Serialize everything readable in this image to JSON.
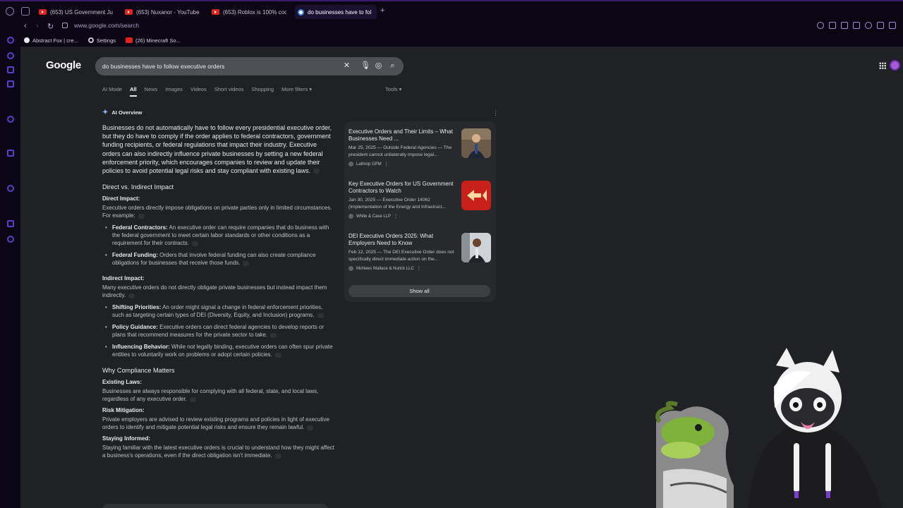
{
  "browser": {
    "tabs": [
      {
        "label": "(653) US Government Ju",
        "icon": "youtube-icon"
      },
      {
        "label": "(653) Nuxanor - YouTube",
        "icon": "youtube-icon"
      },
      {
        "label": "(653) Roblox is 100% coo",
        "icon": "youtube-icon"
      },
      {
        "label": "do businesses have to fol",
        "icon": "google-icon",
        "active": true
      }
    ],
    "new_tab": "+",
    "url": "www.google.com/search",
    "bookmarks": [
      {
        "label": "Abstract Fox | cre..."
      },
      {
        "label": "Settings"
      },
      {
        "label": "(26) Minecraft So..."
      }
    ]
  },
  "google": {
    "logo": "Google",
    "query": "do businesses have to follow executive orders",
    "tabs": [
      "AI Mode",
      "All",
      "News",
      "Images",
      "Videos",
      "Short videos",
      "Shopping",
      "More filters"
    ],
    "active_tab": "All",
    "tools": "Tools"
  },
  "ai_overview": {
    "heading": "AI Overview",
    "summary": "Businesses do not automatically have to follow every presidential executive order, but they do have to comply if the order applies to federal contractors, government funding recipients, or federal regulations that impact their industry. Executive orders can also indirectly influence private businesses by setting a new federal enforcement priority, which encourages companies to review and update their policies to avoid potential legal risks and stay compliant with existing laws.",
    "section1": {
      "title": "Direct vs. Indirect Impact",
      "direct_title": "Direct Impact:",
      "direct_text": "Executive orders directly impose obligations on private parties only in limited circumstances. For example:",
      "direct_items": [
        {
          "bold": "Federal Contractors:",
          "text": " An executive order can require companies that do business with the federal government to meet certain labor standards or other conditions as a requirement for their contracts."
        },
        {
          "bold": "Federal Funding:",
          "text": " Orders that involve federal funding can also create compliance obligations for businesses that receive those funds."
        }
      ],
      "indirect_title": "Indirect Impact:",
      "indirect_text": "Many executive orders do not directly obligate private businesses but instead impact them indirectly.",
      "indirect_items": [
        {
          "bold": "Shifting Priorities:",
          "text": " An order might signal a change in federal enforcement priorities, such as targeting certain types of DEI (Diversity, Equity, and Inclusion) programs."
        },
        {
          "bold": "Policy Guidance:",
          "text": " Executive orders can direct federal agencies to develop reports or plans that recommend measures for the private sector to take."
        },
        {
          "bold": "Influencing Behavior:",
          "text": " While not legally binding, executive orders can often spur private entities to voluntarily work on problems or adopt certain policies."
        }
      ]
    },
    "section2": {
      "title": "Why Compliance Matters",
      "items": [
        {
          "title": "Existing Laws:",
          "text": "Businesses are always responsible for complying with all federal, state, and local laws, regardless of any executive order."
        },
        {
          "title": "Risk Mitigation:",
          "text": "Private employers are advised to review existing programs and policies in light of executive orders to identify and mitigate potential legal risks and ensure they remain lawful."
        },
        {
          "title": "Staying Informed:",
          "text": "Staying familiar with the latest executive orders is crucial to understand how they might affect a business's operations, even if the direct obligation isn't immediate."
        }
      ]
    }
  },
  "sources": {
    "items": [
      {
        "title": "Executive Orders and Their Limits – What Businesses Need ...",
        "snippet": "Mar 25, 2025 — Outside Federal Agencies — The president cannot unilaterally impose legal...",
        "site": "Lathrop GPM"
      },
      {
        "title": "Key Executive Orders for US Government Contractors to Watch",
        "snippet": "Jan 30, 2025 — Executive Order 14062 (Implementation of the Energy and Infrastruct...",
        "site": "White & Case LLP"
      },
      {
        "title": "DEI Executive Orders 2025: What Employers Need to Know",
        "snippet": "Feb 12, 2025 — The DEI Executive Order does not specifically direct immediate action on the...",
        "site": "McNees Wallace & Nurick LLC"
      }
    ],
    "show_all": "Show all"
  },
  "colors": {
    "page_bg": "#202124",
    "browser_bg": "#0b0717",
    "accent": "#8ab4f8",
    "search_bg": "#4d5156"
  }
}
